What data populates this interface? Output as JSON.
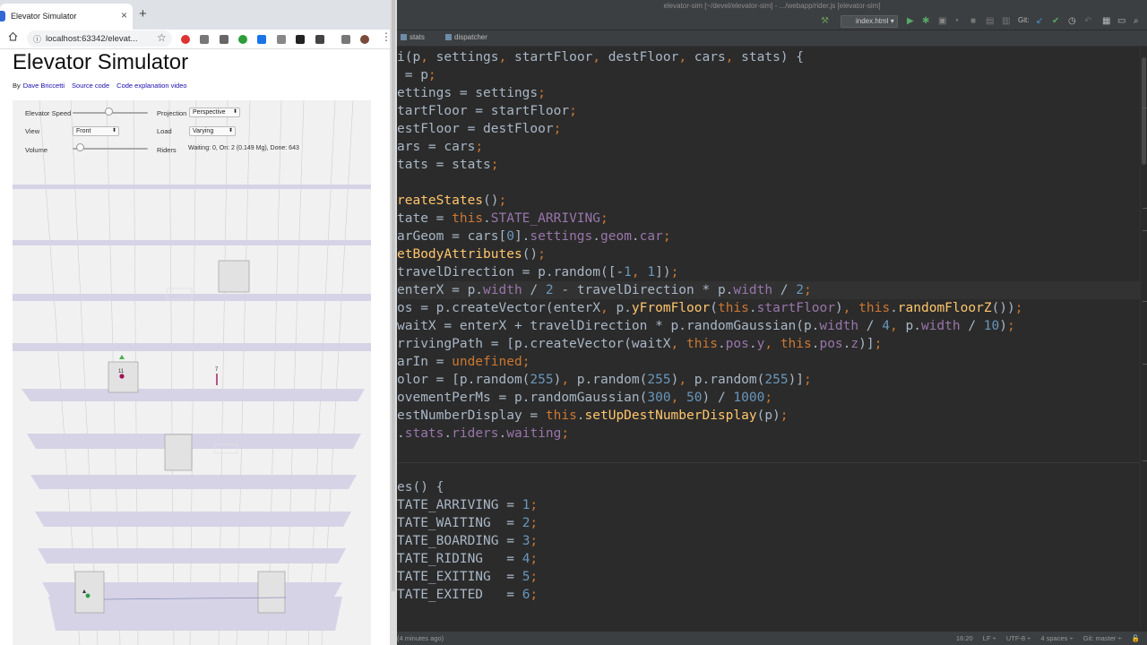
{
  "browser": {
    "tab_title": "Elevator Simulator",
    "tab_close": "×",
    "new_tab": "+",
    "url": "localhost:63342/elevat...",
    "page": {
      "title": "Elevator Simulator",
      "byline_prefix": "By",
      "author_link": "Dave Briccetti",
      "source_link": "Source code",
      "video_link": "Code explanation video"
    },
    "controls": {
      "speed_label": "Elevator Speed",
      "speed_level": 0.48,
      "projection_label": "Projection",
      "projection_value": "Perspective",
      "view_label": "View",
      "view_value": "Front",
      "load_label": "Load",
      "load_value": "Varying",
      "volume_label": "Volume",
      "volume_level": 0.05,
      "riders_label": "Riders",
      "riders_status": "Waiting: 0, On: 2 (0.149 Mg), Done: 643"
    },
    "scene": {
      "car_indicator_floor": "11",
      "rider_dest": "7"
    }
  },
  "ide": {
    "window_title": "elevator-sim [~/devel/elevator-sim] - .../webapp/rider.js [elevator-sim]",
    "tabs": [
      "stats",
      "dispatcher"
    ],
    "run_config": "index.html",
    "git_label": "Git:",
    "code_lines": [
      "i(p, settings, startFloor, destFloor, cars, stats) {",
      " = p;",
      "ettings = settings;",
      "tartFloor = startFloor;",
      "estFloor = destFloor;",
      "ars = cars;",
      "tats = stats;",
      "",
      "reateStates();",
      "tate = this.STATE_ARRIVING;",
      "arGeom = cars[0].settings.geom.car;",
      "etBodyAttributes();",
      "travelDirection = p.random([-1, 1]);",
      "enterX = p.width / 2 - travelDirection * p.width / 2;",
      "os = p.createVector(enterX, p.yFromFloor(this.startFloor), this.randomFloorZ());",
      "waitX = enterX + travelDirection * p.randomGaussian(p.width / 4, p.width / 10);",
      "rrivingPath = [p.createVector(waitX, this.pos.y, this.pos.z)];",
      "arIn = undefined;",
      "olor = [p.random(255), p.random(255), p.random(255)];",
      "ovementPerMs = p.randomGaussian(300, 50) / 1000;",
      "estNumberDisplay = this.setUpDestNumberDisplay(p);",
      ".stats.riders.waiting;",
      "",
      "",
      "es() {",
      "TATE_ARRIVING = 1;",
      "TATE_WAITING  = 2;",
      "TATE_BOARDING = 3;",
      "TATE_RIDING   = 4;",
      "TATE_EXITING  = 5;",
      "TATE_EXITED   = 6;"
    ],
    "status": {
      "left": "(4 minutes ago)",
      "position": "16:20",
      "line_sep": "LF ÷",
      "encoding": "UTF-8 ÷",
      "indent": "4 spaces ÷",
      "vcs": "Git: master ÷"
    },
    "colors": {
      "background": "#2b2b2b",
      "keyword": "#cc7832",
      "property": "#9876aa",
      "function": "#ffc66d",
      "number": "#6897bb",
      "default": "#a9b7c6"
    }
  }
}
